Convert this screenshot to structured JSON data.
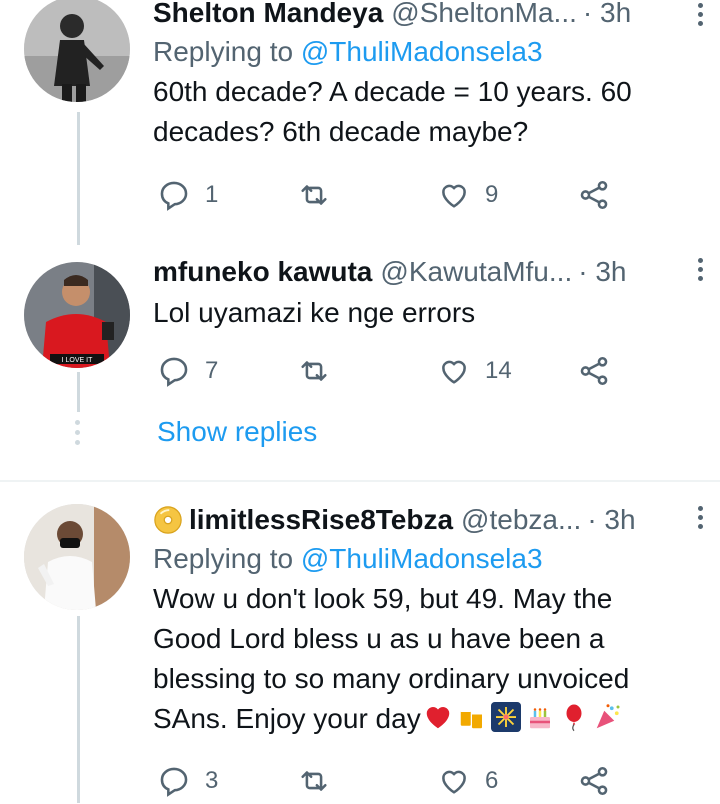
{
  "tweets": [
    {
      "name": "Shelton Mandeya",
      "handle": "@SheltonMa...",
      "time": "· 3h",
      "replying_label": "Replying to",
      "replying_to": "@ThuliMadonsela3",
      "text_lines": [
        "60th decade? A decade = 10 years. 60",
        "decades? 6th decade maybe?"
      ],
      "replies": "1",
      "retweets": "",
      "likes": "9"
    },
    {
      "name": "mfuneko kawuta",
      "handle": "@KawutaMfu...",
      "time": "· 3h",
      "avatar_caption": "I LOVE IT",
      "text_lines": [
        "Lol uyamazi ke nge errors"
      ],
      "replies": "7",
      "retweets": "",
      "likes": "14"
    },
    {
      "name": "limitlessRise8Tebza",
      "handle": "@tebza...",
      "time": "· 3h",
      "replying_label": "Replying to",
      "replying_to": "@ThuliMadonsela3",
      "text_lines": [
        "Wow u don't look 59, but 49. May the",
        "Good Lord bless u as u have been a",
        "blessing to so many ordinary unvoiced",
        "SAns. Enjoy your day"
      ],
      "replies": "3",
      "retweets": "",
      "likes": "6"
    }
  ],
  "show_replies": "Show replies",
  "colors": {
    "accent": "#1d9bf0",
    "secondary": "#536471",
    "line": "#cfd9de"
  },
  "icons": [
    "reply-icon",
    "retweet-icon",
    "like-icon",
    "share-icon",
    "more-icon"
  ]
}
